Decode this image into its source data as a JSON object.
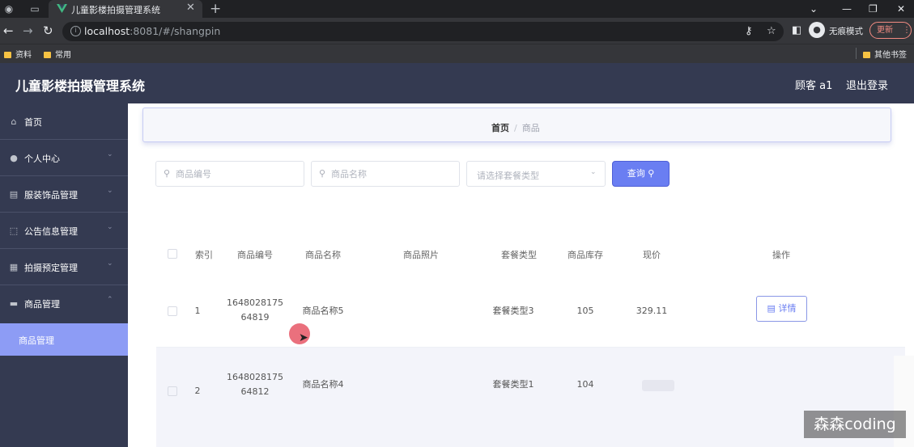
{
  "browser": {
    "tab_title": "儿童影楼拍摄管理系统",
    "url_host": "localhost",
    "url_rest": ":8081/#/shangpin",
    "incognito_label": "无痕模式",
    "update_label": "更新",
    "bookmarks": [
      "资料",
      "常用"
    ],
    "other_bookmarks": "其他书签"
  },
  "header": {
    "title": "儿童影楼拍摄管理系统",
    "user": "顾客 a1",
    "logout": "退出登录"
  },
  "sidebar": {
    "items": [
      {
        "label": "首页",
        "icon": "home-icon"
      },
      {
        "label": "个人中心",
        "icon": "user-icon"
      },
      {
        "label": "服装饰品管理",
        "icon": "document-icon"
      },
      {
        "label": "公告信息管理",
        "icon": "frame-icon"
      },
      {
        "label": "拍摄预定管理",
        "icon": "grid-icon"
      },
      {
        "label": "商品管理",
        "icon": "ticket-icon"
      }
    ],
    "active_sub": "商品管理"
  },
  "breadcrumb": {
    "home": "首页",
    "separator": "/",
    "current": "商品"
  },
  "search": {
    "code_placeholder": "商品编号",
    "name_placeholder": "商品名称",
    "type_placeholder": "请选择套餐类型",
    "query_label": "查询"
  },
  "table": {
    "headers": {
      "index": "索引",
      "code": "商品编号",
      "name": "商品名称",
      "photo": "商品照片",
      "type": "套餐类型",
      "stock": "商品库存",
      "price": "现价",
      "action": "操作"
    },
    "rows": [
      {
        "index": "1",
        "code_line1": "1648028175",
        "code_line2": "64819",
        "name": "商品名称5",
        "type": "套餐类型3",
        "stock": "105",
        "price": "329.11",
        "action": "详情"
      },
      {
        "index": "2",
        "code_line1": "1648028175",
        "code_line2": "64812",
        "name": "商品名称4",
        "type": "套餐类型1",
        "stock": "104",
        "price": "",
        "action": ""
      }
    ]
  },
  "watermark": "森森coding",
  "colors": {
    "header_bg": "#343a51",
    "accent": "#6a7ef2",
    "submenu_active": "#8d9cf5"
  }
}
